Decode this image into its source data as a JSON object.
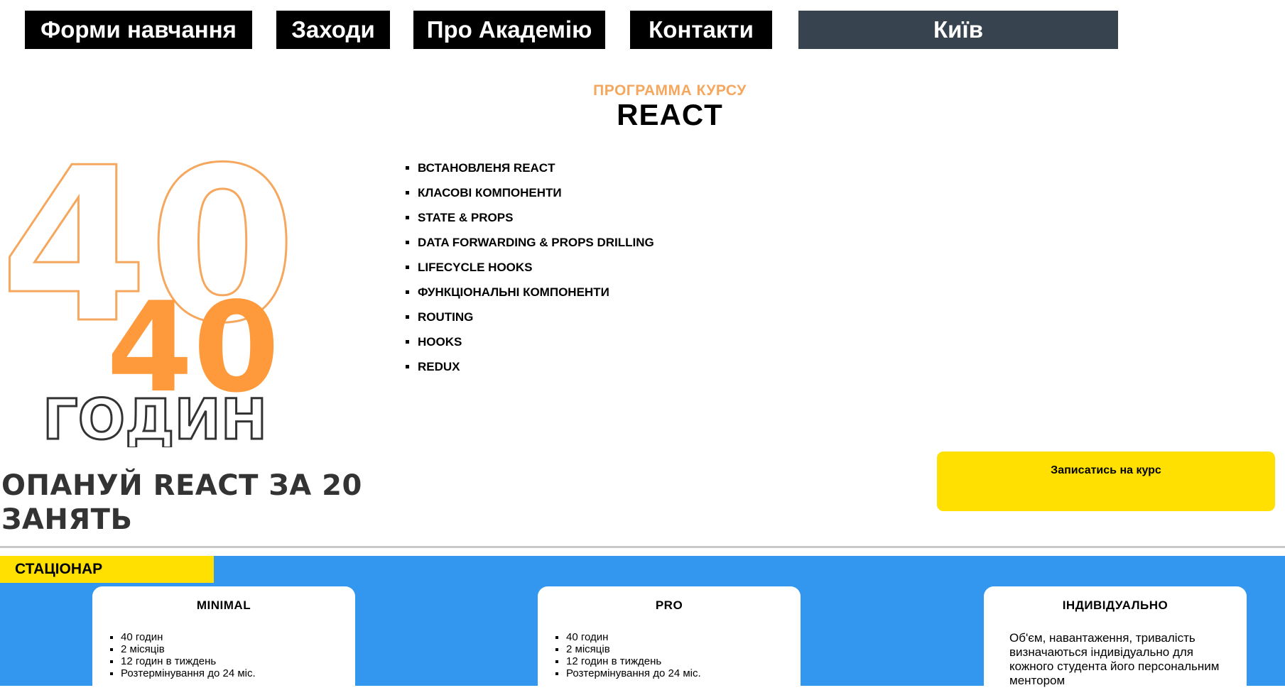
{
  "nav": {
    "items": [
      {
        "label": "Форми навчання"
      },
      {
        "label": "Заходи"
      },
      {
        "label": "Про Академію"
      },
      {
        "label": "Контакти"
      }
    ],
    "city": "Київ"
  },
  "course": {
    "kicker": "ПРОГРАММА КУРСУ",
    "title": "REACT",
    "hours_big": "40",
    "hours_number": "40",
    "hours_word": "ГОДИН",
    "topics": [
      "ВСТАНОВЛЕНЯ REACT",
      "КЛАСОВІ КОМПОНЕНТИ",
      "STATE & PROPS",
      "DATA FORWARDING & PROPS DRILLING",
      "LIFECYCLE HOOKS",
      "ФУНКЦІОНАЛЬНІ КОМПОНЕНТИ",
      "ROUTING",
      "HOOKS",
      "REDUX"
    ],
    "tagline_line1": "ОПАНУЙ REACT ЗА 20",
    "tagline_line2": "ЗАНЯТЬ",
    "enroll_label": "Записатись на курс"
  },
  "pricing": {
    "mode": "СТАЦІОНАР",
    "plans": [
      {
        "name": "MINIMAL",
        "features": [
          "40 годин",
          "2 місяців",
          "12 годин в тиждень",
          "Розтермінування до 24 міс."
        ]
      },
      {
        "name": "PRO",
        "features": [
          "40 годин",
          "2 місяців",
          "12 годин в тиждень",
          "Розтермінування до 24 міс."
        ]
      },
      {
        "name": "ІНДИВІДУАЛЬНО",
        "description": "Об'єм, навантаження, тривалість визначаються індивідуально для кожного студента його персональним ментором"
      }
    ]
  },
  "colors": {
    "accent_orange": "#f6a75e",
    "hours_orange": "#ff9a3c",
    "yellow": "#ffe000",
    "blue": "#3397f0",
    "nav_dark": "#37434f"
  }
}
